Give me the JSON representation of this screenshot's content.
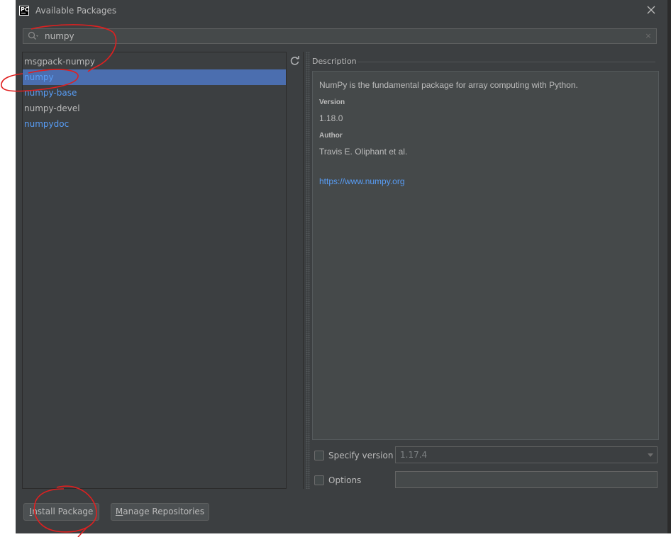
{
  "window": {
    "title": "Available Packages",
    "logo_text": "PC"
  },
  "search": {
    "value": "numpy",
    "clear_glyph": "×"
  },
  "packages": [
    {
      "name": "msgpack-numpy",
      "selected": false,
      "color": "#bbbbbb"
    },
    {
      "name": "numpy",
      "selected": true,
      "color": "#589df6"
    },
    {
      "name": "numpy-base",
      "selected": false,
      "color": "#589df6"
    },
    {
      "name": "numpy-devel",
      "selected": false,
      "color": "#bbbbbb"
    },
    {
      "name": "numpydoc",
      "selected": false,
      "color": "#589df6"
    }
  ],
  "description": {
    "label": "Description",
    "summary": "NumPy is the fundamental package for array computing with Python.",
    "version_heading": "Version",
    "version": "1.18.0",
    "author_heading": "Author",
    "author": "Travis E. Oliphant et al.",
    "url": "https://www.numpy.org"
  },
  "options": {
    "specify_version_label": "Specify version",
    "specify_version_checked": false,
    "version_value": "1.17.4",
    "options_label": "Options",
    "options_checked": false,
    "options_value": ""
  },
  "buttons": {
    "install_mnemonic": "I",
    "install_rest": "nstall Package",
    "manage_mnemonic": "M",
    "manage_rest": "anage Repositories"
  },
  "colors": {
    "background": "#3c3f41",
    "selection": "#4b6eaf",
    "link": "#589df6",
    "text": "#bbbbbb",
    "annotation": "#e02020"
  },
  "icons": {
    "logo": "pycharm-logo-icon",
    "close": "close-icon",
    "search": "search-icon",
    "refresh": "refresh-icon",
    "combo": "chevron-down-icon"
  }
}
